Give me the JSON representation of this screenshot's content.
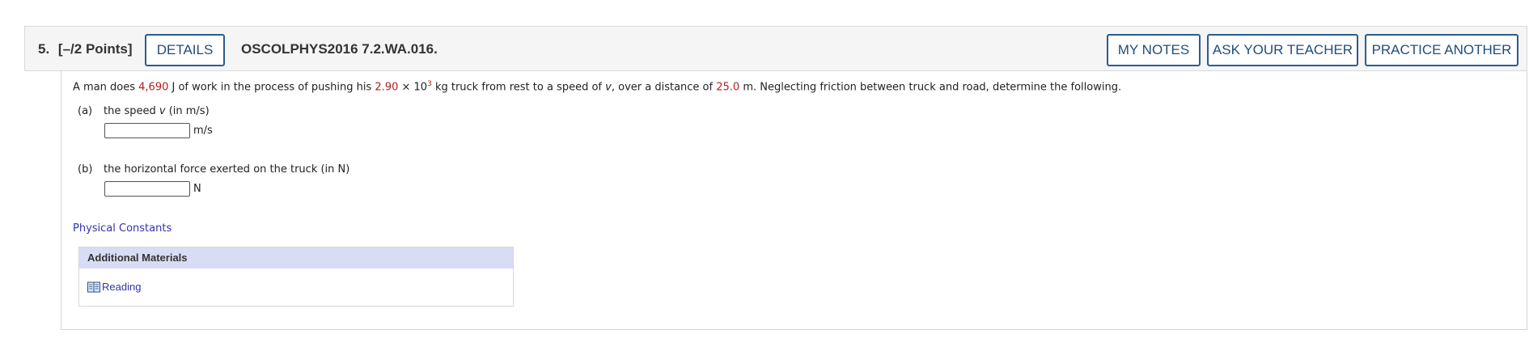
{
  "header": {
    "question_number": "5.",
    "points": "[–/2 Points]",
    "details_label": "DETAILS",
    "assignment_code": "OSCOLPHYS2016 7.2.WA.016.",
    "my_notes_label": "MY NOTES",
    "ask_teacher_label": "ASK YOUR TEACHER",
    "practice_label": "PRACTICE ANOTHER"
  },
  "problem": {
    "t1": "A man does ",
    "work_value": "4,690",
    "t2": " J of work in the process of pushing his ",
    "mass_value": "2.90",
    "t3": " × 10",
    "exponent": "3",
    "t4": " kg truck from rest to a speed of ",
    "v_symbol": "v",
    "t5": ", over a distance of ",
    "distance_value": "25.0",
    "t6": " m. Neglecting friction between truck and road, determine the following."
  },
  "parts": {
    "a": {
      "label": "(a)",
      "text_before": "the speed ",
      "symbol": "v",
      "text_after": " (in m/s)",
      "value": "",
      "unit": "m/s"
    },
    "b": {
      "label": "(b)",
      "text": "the horizontal force exerted on the truck (in N)",
      "value": "",
      "unit": "N"
    }
  },
  "physical_constants_label": "Physical Constants",
  "additional_materials": {
    "heading": "Additional Materials",
    "reading_label": "Reading"
  },
  "colors": {
    "button_border": "#2a5e8c",
    "button_text": "#1f4e79",
    "value_red": "#b21f1f",
    "link": "#3333aa",
    "materials_header_bg": "#d8ddf5"
  },
  "icons": {
    "reading": "book-icon"
  }
}
